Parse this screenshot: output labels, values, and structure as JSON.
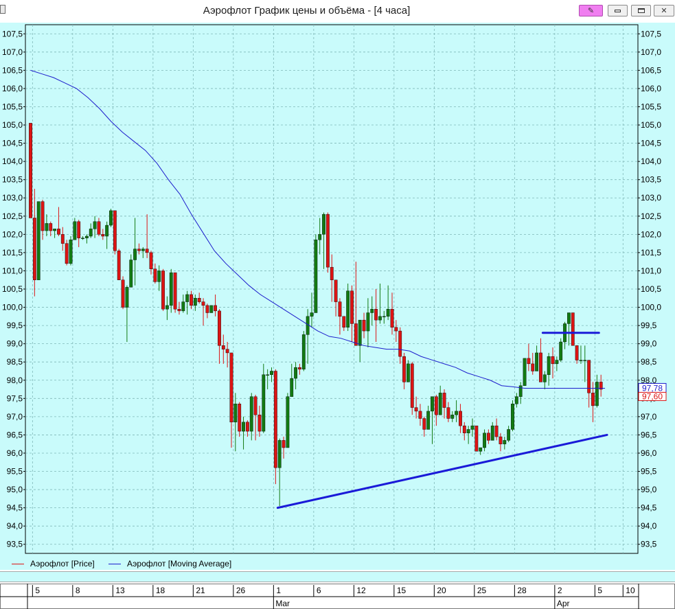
{
  "window": {
    "title": "Аэрофлот График цены и объёма - [4 часа]",
    "pin_glyph": "✎",
    "close_glyph": "✕"
  },
  "legend": {
    "price_label": "Аэрофлот [Price]",
    "ma_label": "Аэрофлот [Moving Average]"
  },
  "colors": {
    "background": "#c9fbfb",
    "up": "#127a12",
    "down": "#dc1414",
    "ma": "#1c1ccc",
    "trend": "#1a1ad8",
    "grid": "#7fb8b8"
  },
  "chart_data": {
    "type": "candlestick",
    "y_axis": {
      "min": 93.25,
      "max": 107.75,
      "step": 0.5,
      "ticks": [
        "93,5",
        "94,0",
        "94,5",
        "95,0",
        "95,5",
        "96,0",
        "96,5",
        "97,0",
        "97,5",
        "98,0",
        "98,5",
        "99,0",
        "99,5",
        "100,0",
        "100,5",
        "101,0",
        "101,5",
        "102,0",
        "102,5",
        "103,0",
        "103,5",
        "104,0",
        "104,5",
        "105,0",
        "105,5",
        "106,0",
        "106,5",
        "107,0",
        "107,5"
      ],
      "both_sides": true
    },
    "x_axis": {
      "day_ticks": [
        {
          "label": "5",
          "i": 1
        },
        {
          "label": "8",
          "i": 11
        },
        {
          "label": "13",
          "i": 21
        },
        {
          "label": "18",
          "i": 31
        },
        {
          "label": "21",
          "i": 41
        },
        {
          "label": "26",
          "i": 51
        },
        {
          "label": "1",
          "i": 61
        },
        {
          "label": "6",
          "i": 71
        },
        {
          "label": "12",
          "i": 81
        },
        {
          "label": "15",
          "i": 91
        },
        {
          "label": "20",
          "i": 101
        },
        {
          "label": "25",
          "i": 111
        },
        {
          "label": "28",
          "i": 121
        },
        {
          "label": "2",
          "i": 131
        },
        {
          "label": "5",
          "i": 141
        },
        {
          "label": "10",
          "i": 148
        }
      ],
      "months": [
        {
          "label": "Mar",
          "i": 61
        },
        {
          "label": "Apr",
          "i": 131
        }
      ]
    },
    "grid": true,
    "candles": [
      [
        105.05,
        105.05,
        102.45,
        102.45
      ],
      [
        102.45,
        103.25,
        100.3,
        100.75
      ],
      [
        100.75,
        102.9,
        100.75,
        102.9
      ],
      [
        102.9,
        102.95,
        101.85,
        102.1
      ],
      [
        102.1,
        102.55,
        101.95,
        102.3
      ],
      [
        102.3,
        102.35,
        101.95,
        102.1
      ],
      [
        102.1,
        102.15,
        101.9,
        102.15
      ],
      [
        102.15,
        102.75,
        101.95,
        102.0
      ],
      [
        102.0,
        102.2,
        101.55,
        101.75
      ],
      [
        101.75,
        101.85,
        101.15,
        101.2
      ],
      [
        101.2,
        101.95,
        101.15,
        101.85
      ],
      [
        101.85,
        102.45,
        101.85,
        102.35
      ],
      [
        102.35,
        102.4,
        101.65,
        101.9
      ],
      [
        101.9,
        101.95,
        101.85,
        101.9
      ],
      [
        101.9,
        102.0,
        101.75,
        101.95
      ],
      [
        101.95,
        102.3,
        101.9,
        102.15
      ],
      [
        102.15,
        102.5,
        101.9,
        102.35
      ],
      [
        102.35,
        102.45,
        101.95,
        102.0
      ],
      [
        102.0,
        102.15,
        101.85,
        101.95
      ],
      [
        101.95,
        102.35,
        101.6,
        102.25
      ],
      [
        102.25,
        102.7,
        102.2,
        102.65
      ],
      [
        102.65,
        102.65,
        101.45,
        101.55
      ],
      [
        101.55,
        101.6,
        100.75,
        100.75
      ],
      [
        100.75,
        100.85,
        99.95,
        100.0
      ],
      [
        100.0,
        100.6,
        99.05,
        100.55
      ],
      [
        100.55,
        101.45,
        100.55,
        101.3
      ],
      [
        101.3,
        102.45,
        100.6,
        101.6
      ],
      [
        101.6,
        101.75,
        101.45,
        101.55
      ],
      [
        101.55,
        101.65,
        101.35,
        101.6
      ],
      [
        101.6,
        102.55,
        101.35,
        101.5
      ],
      [
        101.5,
        101.55,
        100.9,
        101.05
      ],
      [
        101.05,
        101.2,
        100.65,
        100.7
      ],
      [
        100.7,
        101.15,
        100.45,
        101.0
      ],
      [
        101.0,
        101.05,
        99.9,
        99.95
      ],
      [
        99.95,
        100.3,
        99.65,
        100.05
      ],
      [
        100.05,
        101.05,
        99.85,
        100.95
      ],
      [
        100.95,
        100.95,
        99.85,
        99.95
      ],
      [
        99.95,
        100.15,
        99.8,
        99.9
      ],
      [
        99.9,
        100.35,
        99.85,
        100.15
      ],
      [
        100.15,
        100.45,
        99.8,
        100.35
      ],
      [
        100.35,
        100.45,
        99.95,
        100.05
      ],
      [
        100.05,
        100.35,
        99.9,
        100.25
      ],
      [
        100.25,
        100.4,
        100.1,
        100.15
      ],
      [
        100.15,
        100.25,
        99.5,
        100.05
      ],
      [
        100.05,
        100.1,
        99.7,
        99.85
      ],
      [
        99.85,
        100.05,
        99.85,
        100.05
      ],
      [
        100.05,
        100.35,
        99.75,
        99.9
      ],
      [
        99.9,
        99.95,
        98.45,
        98.95
      ],
      [
        98.95,
        99.25,
        98.45,
        98.85
      ],
      [
        98.85,
        99.05,
        98.35,
        98.75
      ],
      [
        98.75,
        98.75,
        96.15,
        96.85
      ],
      [
        96.85,
        97.65,
        96.05,
        97.35
      ],
      [
        97.35,
        97.4,
        96.45,
        96.6
      ],
      [
        96.6,
        97.0,
        96.1,
        96.85
      ],
      [
        96.85,
        96.9,
        96.45,
        96.6
      ],
      [
        96.6,
        97.65,
        96.35,
        97.55
      ],
      [
        97.55,
        97.6,
        96.35,
        97.05
      ],
      [
        97.05,
        97.3,
        96.45,
        96.6
      ],
      [
        96.6,
        98.45,
        96.55,
        98.15
      ],
      [
        98.15,
        98.3,
        97.75,
        98.15
      ],
      [
        98.15,
        98.35,
        97.95,
        98.25
      ],
      [
        98.25,
        98.3,
        95.15,
        95.6
      ],
      [
        95.6,
        96.4,
        94.55,
        96.35
      ],
      [
        96.35,
        96.45,
        95.85,
        96.15
      ],
      [
        96.15,
        97.65,
        96.15,
        97.55
      ],
      [
        97.55,
        98.45,
        97.55,
        98.05
      ],
      [
        98.05,
        98.5,
        97.75,
        98.35
      ],
      [
        98.35,
        98.45,
        98.15,
        98.3
      ],
      [
        98.3,
        99.35,
        98.25,
        99.25
      ],
      [
        99.25,
        99.95,
        98.45,
        99.75
      ],
      [
        99.75,
        100.4,
        99.45,
        99.85
      ],
      [
        99.85,
        102.0,
        99.85,
        101.85
      ],
      [
        101.85,
        102.45,
        101.45,
        102.0
      ],
      [
        102.0,
        102.6,
        101.05,
        102.55
      ],
      [
        102.55,
        102.6,
        100.95,
        101.1
      ],
      [
        101.1,
        101.45,
        100.15,
        100.75
      ],
      [
        100.75,
        100.75,
        99.75,
        100.15
      ],
      [
        100.15,
        100.25,
        99.25,
        99.75
      ],
      [
        99.75,
        99.75,
        99.35,
        99.45
      ],
      [
        99.45,
        100.65,
        99.35,
        100.45
      ],
      [
        100.45,
        100.6,
        99.05,
        99.55
      ],
      [
        99.55,
        101.25,
        99.0,
        98.95
      ],
      [
        98.95,
        99.65,
        98.5,
        99.65
      ],
      [
        99.65,
        99.85,
        99.15,
        99.35
      ],
      [
        99.35,
        100.25,
        98.9,
        99.85
      ],
      [
        99.85,
        100.3,
        99.5,
        99.95
      ],
      [
        99.95,
        100.5,
        99.05,
        99.65
      ],
      [
        99.65,
        100.65,
        99.55,
        99.75
      ],
      [
        99.75,
        99.9,
        99.55,
        99.75
      ],
      [
        99.75,
        100.6,
        99.65,
        99.95
      ],
      [
        99.95,
        100.4,
        99.25,
        99.45
      ],
      [
        99.45,
        99.65,
        99.05,
        99.35
      ],
      [
        99.35,
        99.45,
        98.45,
        98.65
      ],
      [
        98.65,
        98.75,
        97.75,
        97.95
      ],
      [
        97.95,
        98.55,
        97.95,
        98.45
      ],
      [
        98.45,
        98.5,
        97.05,
        97.25
      ],
      [
        97.25,
        97.55,
        96.95,
        97.15
      ],
      [
        97.15,
        97.35,
        96.75,
        96.95
      ],
      [
        96.95,
        97.0,
        96.45,
        96.65
      ],
      [
        96.65,
        97.3,
        96.65,
        97.15
      ],
      [
        97.15,
        97.55,
        96.25,
        97.55
      ],
      [
        97.55,
        97.6,
        96.75,
        97.05
      ],
      [
        97.05,
        97.85,
        97.05,
        97.65
      ],
      [
        97.65,
        97.75,
        96.95,
        97.25
      ],
      [
        97.25,
        97.4,
        96.85,
        96.95
      ],
      [
        96.95,
        97.15,
        96.85,
        97.05
      ],
      [
        97.05,
        97.45,
        96.85,
        97.15
      ],
      [
        97.15,
        97.35,
        96.55,
        96.75
      ],
      [
        96.75,
        96.85,
        96.35,
        96.55
      ],
      [
        96.55,
        96.75,
        96.25,
        96.65
      ],
      [
        96.65,
        96.95,
        96.45,
        96.75
      ],
      [
        96.75,
        96.75,
        96.05,
        96.05
      ],
      [
        96.05,
        96.15,
        95.95,
        96.15
      ],
      [
        96.15,
        96.65,
        96.05,
        96.55
      ],
      [
        96.55,
        96.65,
        96.25,
        96.35
      ],
      [
        96.35,
        96.85,
        96.35,
        96.75
      ],
      [
        96.75,
        96.95,
        96.35,
        96.45
      ],
      [
        96.45,
        96.55,
        96.05,
        96.25
      ],
      [
        96.25,
        96.45,
        96.1,
        96.35
      ],
      [
        96.35,
        96.75,
        96.3,
        96.65
      ],
      [
        96.65,
        97.45,
        96.6,
        97.35
      ],
      [
        97.35,
        97.65,
        97.25,
        97.55
      ],
      [
        97.55,
        97.95,
        97.35,
        97.85
      ],
      [
        97.85,
        98.6,
        97.85,
        98.6
      ],
      [
        98.6,
        99.0,
        98.25,
        98.45
      ],
      [
        98.45,
        98.75,
        98.15,
        98.25
      ],
      [
        98.25,
        98.95,
        98.25,
        98.75
      ],
      [
        98.75,
        99.15,
        97.95,
        97.95
      ],
      [
        97.95,
        98.25,
        97.75,
        98.15
      ],
      [
        98.15,
        98.75,
        97.85,
        98.65
      ],
      [
        98.65,
        98.9,
        98.05,
        98.45
      ],
      [
        98.45,
        98.65,
        98.25,
        98.55
      ],
      [
        98.55,
        99.15,
        98.5,
        99.05
      ],
      [
        99.05,
        99.6,
        98.85,
        99.55
      ],
      [
        99.55,
        99.85,
        98.95,
        99.85
      ],
      [
        99.85,
        99.85,
        98.95,
        98.95
      ],
      [
        98.95,
        98.95,
        98.45,
        98.55
      ],
      [
        98.55,
        98.95,
        98.45,
        98.55
      ],
      [
        98.55,
        98.95,
        97.95,
        98.55
      ],
      [
        98.55,
        98.55,
        97.25,
        97.65
      ],
      [
        97.65,
        97.95,
        96.85,
        97.3
      ],
      [
        97.3,
        98.15,
        97.25,
        97.95
      ],
      [
        97.95,
        98.15,
        97.55,
        97.75
      ]
    ],
    "moving_average": [
      [
        0,
        106.5
      ],
      [
        4,
        106.4
      ],
      [
        8,
        106.3
      ],
      [
        12,
        106.15
      ],
      [
        16,
        106.0
      ],
      [
        20,
        105.75
      ],
      [
        24,
        105.45
      ],
      [
        28,
        105.1
      ],
      [
        32,
        104.8
      ],
      [
        36,
        104.55
      ],
      [
        40,
        104.3
      ],
      [
        44,
        103.95
      ],
      [
        48,
        103.5
      ],
      [
        52,
        103.1
      ],
      [
        56,
        102.55
      ],
      [
        60,
        102.05
      ],
      [
        64,
        101.55
      ],
      [
        68,
        101.2
      ],
      [
        72,
        100.9
      ],
      [
        76,
        100.6
      ],
      [
        80,
        100.35
      ],
      [
        84,
        100.15
      ],
      [
        88,
        99.95
      ],
      [
        92,
        99.75
      ],
      [
        96,
        99.55
      ],
      [
        100,
        99.35
      ],
      [
        104,
        99.2
      ],
      [
        108,
        99.15
      ],
      [
        112,
        99.05
      ],
      [
        116,
        98.95
      ],
      [
        120,
        98.9
      ],
      [
        124,
        98.85
      ],
      [
        128,
        98.85
      ],
      [
        132,
        98.8
      ],
      [
        136,
        98.65
      ],
      [
        140,
        98.55
      ],
      [
        144,
        98.45
      ],
      [
        148,
        98.35
      ],
      [
        152,
        98.2
      ],
      [
        156,
        98.1
      ],
      [
        160,
        98.0
      ],
      [
        164,
        97.85
      ],
      [
        168,
        97.82
      ],
      [
        172,
        97.78
      ],
      [
        176,
        97.78
      ],
      [
        180,
        97.78
      ],
      [
        184,
        97.78
      ],
      [
        188,
        97.78
      ],
      [
        192,
        97.78
      ],
      [
        196,
        97.78
      ],
      [
        200,
        97.78
      ]
    ],
    "trendlines": [
      {
        "from": [
          61.5,
          94.5
        ],
        "to": [
          143.5,
          96.5
        ]
      },
      {
        "from": [
          127.5,
          99.3
        ],
        "to": [
          141.5,
          99.3
        ]
      }
    ],
    "last_values": {
      "ma": "97,78",
      "price": "97,60"
    }
  }
}
